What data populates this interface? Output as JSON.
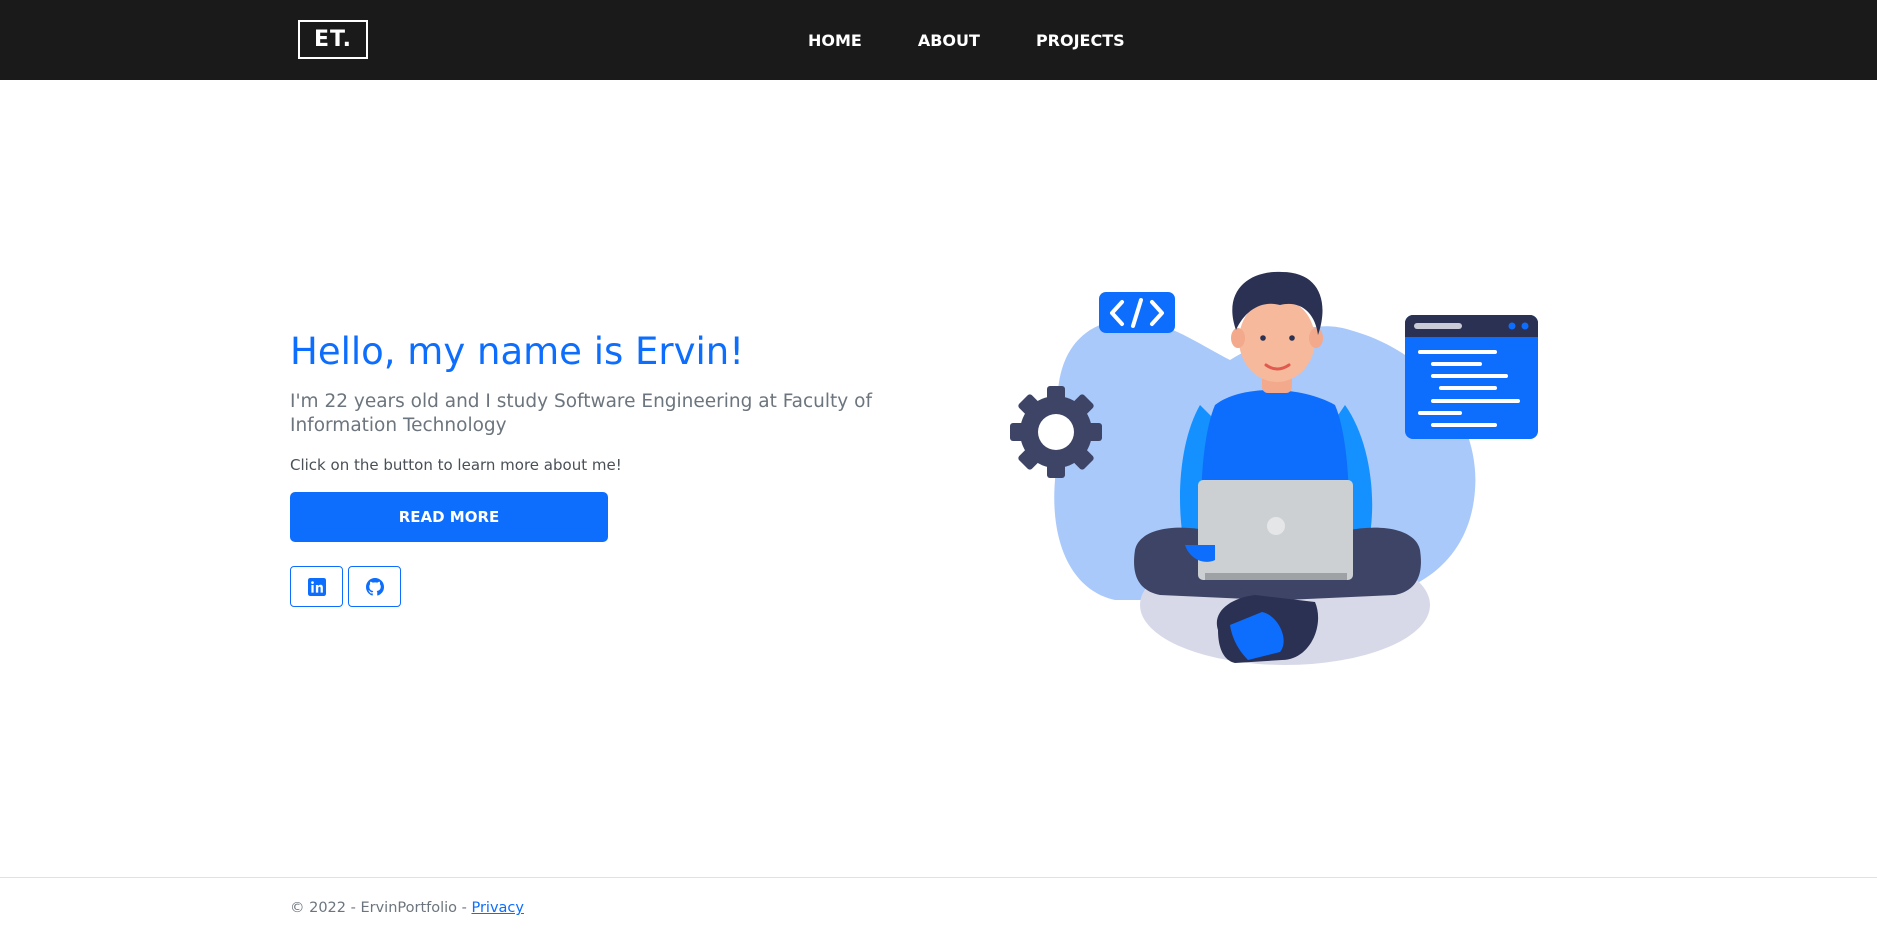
{
  "header": {
    "logo_text": "ET.",
    "nav": [
      {
        "label": "HOME"
      },
      {
        "label": "ABOUT"
      },
      {
        "label": "PROJECTS"
      }
    ]
  },
  "hero": {
    "title": "Hello, my name is Ervin!",
    "lead": "I'm 22 years old and I study Software Engineering at Faculty of Information Technology",
    "subtitle": "Click on the button to learn more about me!",
    "button_label": "READ MORE",
    "social_icons": [
      "linkedin-icon",
      "github-icon"
    ]
  },
  "footer": {
    "copyright": "© 2022 - ErvinPortfolio - ",
    "privacy_label": "Privacy"
  },
  "colors": {
    "primary": "#0d6efd",
    "navbar": "#1a1a1a",
    "text_muted": "#6c757d"
  }
}
